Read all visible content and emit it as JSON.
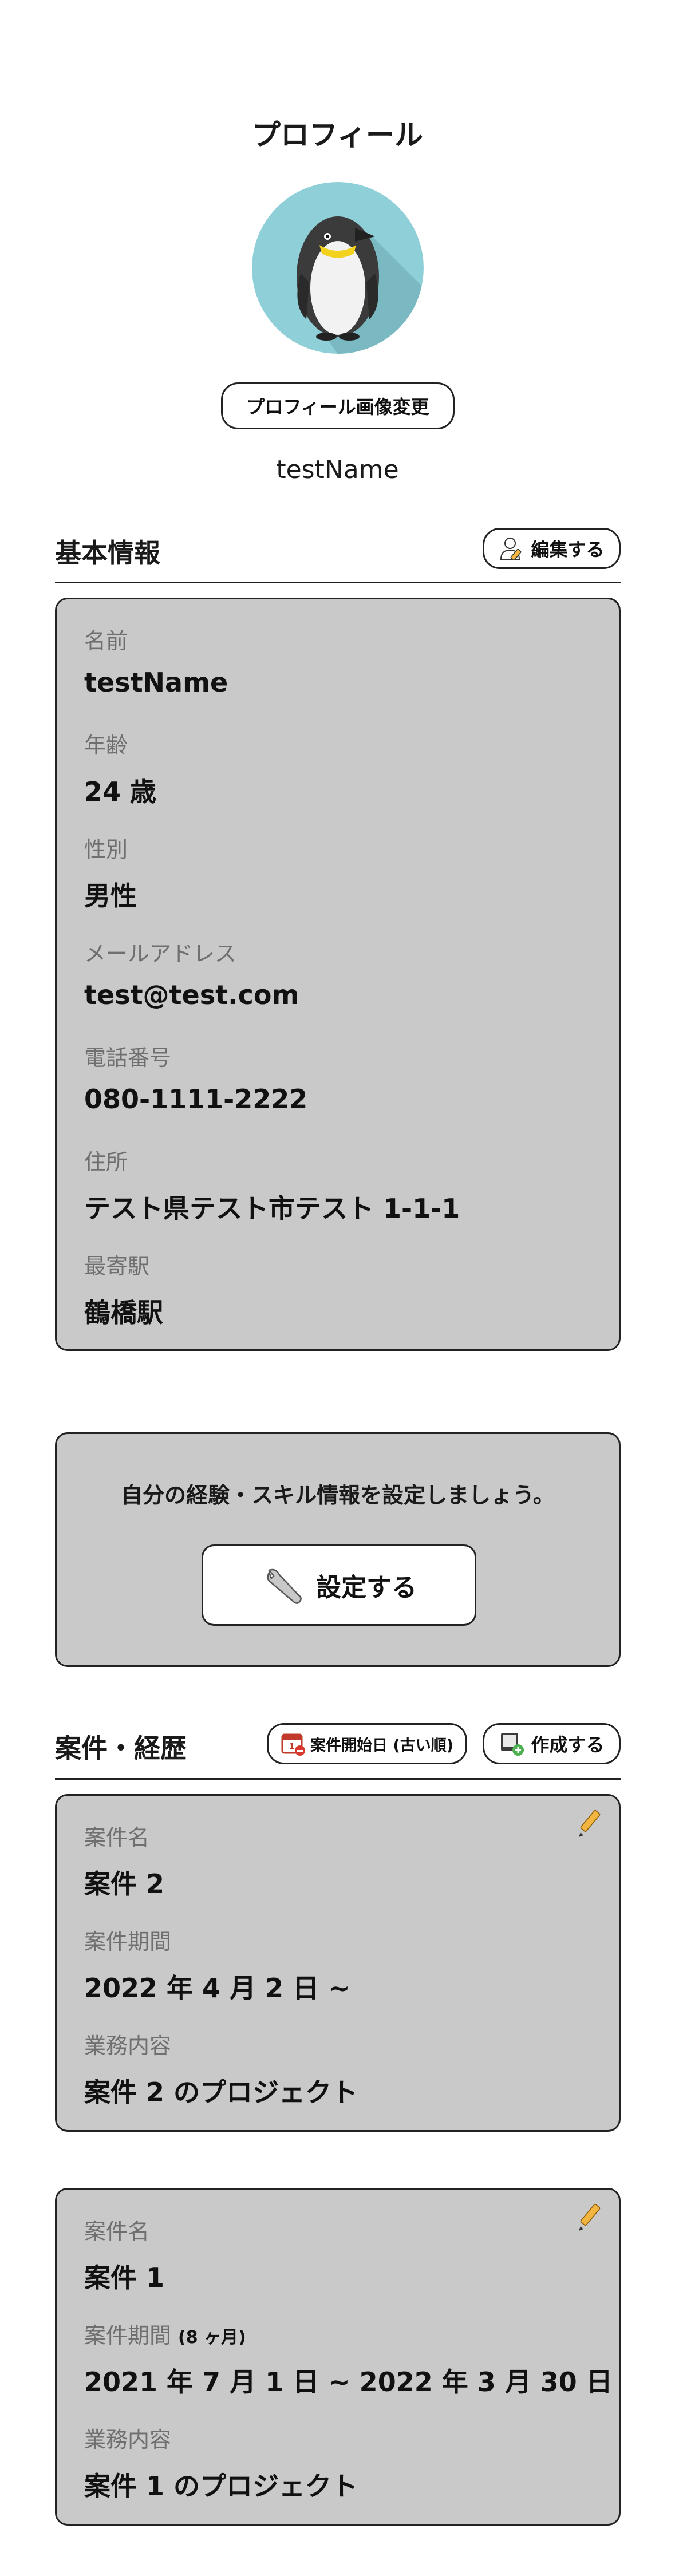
{
  "header": {
    "title": "プロフィール"
  },
  "profile": {
    "change_photo_label": "プロフィール画像変更",
    "username": "testName"
  },
  "basic_info": {
    "title": "基本情報",
    "edit_label": "編集する",
    "fields": [
      {
        "label": "名前",
        "value": "testName"
      },
      {
        "label": "年齢",
        "value": "24 歳"
      },
      {
        "label": "性別",
        "value": "男性"
      },
      {
        "label": "メールアドレス",
        "value": "test@test.com"
      },
      {
        "label": "電話番号",
        "value": "080-1111-2222"
      },
      {
        "label": "住所",
        "value": "テスト県テスト市テスト 1-1-1"
      },
      {
        "label": "最寄駅",
        "value": "鶴橋駅"
      }
    ]
  },
  "skills": {
    "prompt": "自分の経験・スキル情報を設定しましょう。",
    "setup_label": "設定する"
  },
  "projects": {
    "title": "案件・経歴",
    "sort_label": "案件開始日 (古い順)",
    "create_label": "作成する",
    "items": [
      {
        "name_label": "案件名",
        "name": "案件 2",
        "period_label": "案件期間",
        "period_note": "",
        "period": "2022 年 4 月 2 日 ~",
        "desc_label": "業務内容",
        "desc": "案件 2 のプロジェクト"
      },
      {
        "name_label": "案件名",
        "name": "案件 1",
        "period_label": "案件期間",
        "period_note": "(8 ヶ月)",
        "period": "2021 年 7 月 1 日 ~ 2022 年 3 月 30 日",
        "desc_label": "業務内容",
        "desc": "案件 1 のプロジェクト"
      }
    ]
  },
  "colors": {
    "card_bg": "#c9c9c9",
    "avatar_bg": "#8fd0d8",
    "pencil": "#f2b640"
  }
}
